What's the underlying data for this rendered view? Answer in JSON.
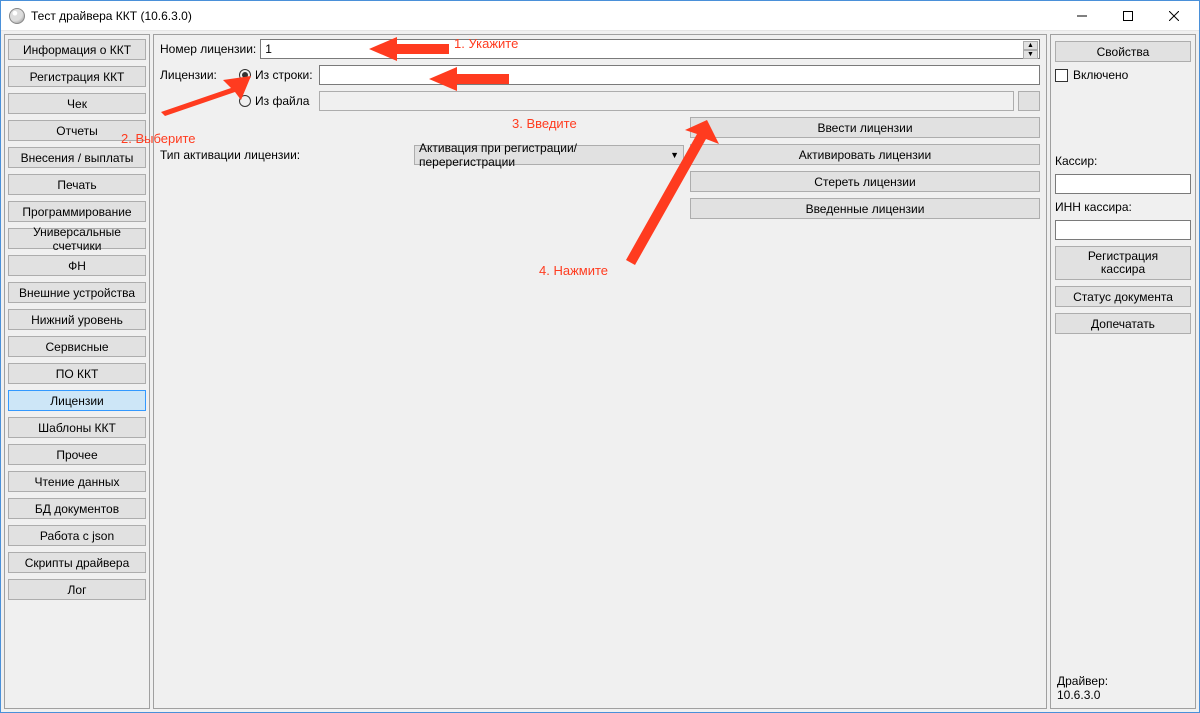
{
  "window": {
    "title": "Тест драйвера ККТ (10.6.3.0)"
  },
  "left_nav": {
    "items": [
      "Информация о ККТ",
      "Регистрация ККТ",
      "Чек",
      "Отчеты",
      "Внесения / выплаты",
      "Печать",
      "Программирование",
      "Универсальные счетчики",
      "ФН",
      "Внешние устройства",
      "Нижний уровень",
      "Сервисные",
      "ПО ККТ",
      "Лицензии",
      "Шаблоны ККТ",
      "Прочее",
      "Чтение данных",
      "БД документов",
      "Работа с json",
      "Скрипты драйвера",
      "Лог"
    ],
    "active_index": 13
  },
  "main": {
    "license_number_label": "Номер лицензии:",
    "license_number_value": "1",
    "licenses_label": "Лицензии:",
    "source_from_string": "Из строки:",
    "source_from_file": "Из файла",
    "string_value": "",
    "file_value": "",
    "activation_type_label": "Тип активации лицензии:",
    "activation_type_value": "Активация при регистрации/перерегистрации",
    "buttons": {
      "enter": "Ввести лицензии",
      "activate": "Активировать лицензии",
      "erase": "Стереть лицензии",
      "entered": "Введенные лицензии"
    }
  },
  "right": {
    "properties_btn": "Свойства",
    "enabled_checkbox": "Включено",
    "cashier_label": "Кассир:",
    "cashier_value": "",
    "inn_label": "ИНН кассира:",
    "inn_value": "",
    "register_cashier_btn": "Регистрация\nкассира",
    "doc_status_btn": "Статус документа",
    "reprint_btn": "Допечатать",
    "driver_label": "Драйвер:",
    "driver_version": "10.6.3.0"
  },
  "annotations": {
    "a1": "1. Укажите",
    "a2": "2. Выберите",
    "a3": "3. Введите",
    "a4": "4. Нажмите"
  }
}
